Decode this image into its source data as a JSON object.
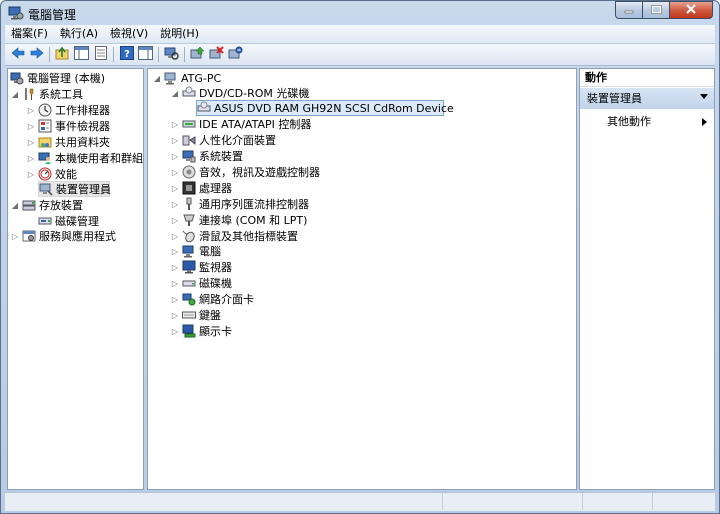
{
  "window": {
    "title": "電腦管理"
  },
  "menu": [
    "檔案(F)",
    "執行(A)",
    "檢視(V)",
    "說明(H)"
  ],
  "left_tree": [
    {
      "label": "電腦管理 (本機)",
      "arrow": "",
      "icon": "computer-management-icon"
    },
    {
      "label": "系統工具",
      "arrow": "◢",
      "icon": "system-tools-icon"
    },
    {
      "label": "工作排程器",
      "arrow": "▷",
      "icon": "task-scheduler-icon"
    },
    {
      "label": "事件檢視器",
      "arrow": "▷",
      "icon": "event-viewer-icon"
    },
    {
      "label": "共用資料夾",
      "arrow": "▷",
      "icon": "shared-folders-icon"
    },
    {
      "label": "本機使用者和群組",
      "arrow": "▷",
      "icon": "local-users-icon"
    },
    {
      "label": "效能",
      "arrow": "▷",
      "icon": "performance-icon"
    },
    {
      "label": "裝置管理員",
      "arrow": "",
      "icon": "device-manager-icon"
    },
    {
      "label": "存放裝置",
      "arrow": "◢",
      "icon": "storage-icon"
    },
    {
      "label": "磁碟管理",
      "arrow": "",
      "icon": "disk-management-icon"
    },
    {
      "label": "服務與應用程式",
      "arrow": "▷",
      "icon": "services-icon"
    }
  ],
  "device_tree": {
    "root": "ATG-PC",
    "categories": [
      {
        "label": "DVD/CD-ROM 光碟機",
        "arrow": "◢",
        "icon": "dvd-drive-icon"
      },
      {
        "label": "ASUS DVD RAM GH92N SCSI CdRom Device",
        "arrow": "",
        "icon": "dvd-drive-icon"
      },
      {
        "label": "IDE ATA/ATAPI 控制器",
        "arrow": "▷",
        "icon": "ide-controller-icon"
      },
      {
        "label": "人性化介面裝置",
        "arrow": "▷",
        "icon": "hid-icon"
      },
      {
        "label": "系統裝置",
        "arrow": "▷",
        "icon": "system-devices-icon"
      },
      {
        "label": "音效，視訊及遊戲控制器",
        "arrow": "▷",
        "icon": "sound-icon"
      },
      {
        "label": "處理器",
        "arrow": "▷",
        "icon": "processor-icon"
      },
      {
        "label": "通用序列匯流排控制器",
        "arrow": "▷",
        "icon": "usb-icon"
      },
      {
        "label": "連接埠 (COM 和 LPT)",
        "arrow": "▷",
        "icon": "ports-icon"
      },
      {
        "label": "滑鼠及其他指標裝置",
        "arrow": "▷",
        "icon": "mouse-icon"
      },
      {
        "label": "電腦",
        "arrow": "▷",
        "icon": "computer-icon"
      },
      {
        "label": "監視器",
        "arrow": "▷",
        "icon": "monitor-icon"
      },
      {
        "label": "磁碟機",
        "arrow": "▷",
        "icon": "disk-drive-icon"
      },
      {
        "label": "網路介面卡",
        "arrow": "▷",
        "icon": "network-adapter-icon"
      },
      {
        "label": "鍵盤",
        "arrow": "▷",
        "icon": "keyboard-icon"
      },
      {
        "label": "顯示卡",
        "arrow": "▷",
        "icon": "display-adapter-icon"
      }
    ]
  },
  "actions": {
    "header": "動作",
    "section": "裝置管理員",
    "item": "其他動作"
  }
}
